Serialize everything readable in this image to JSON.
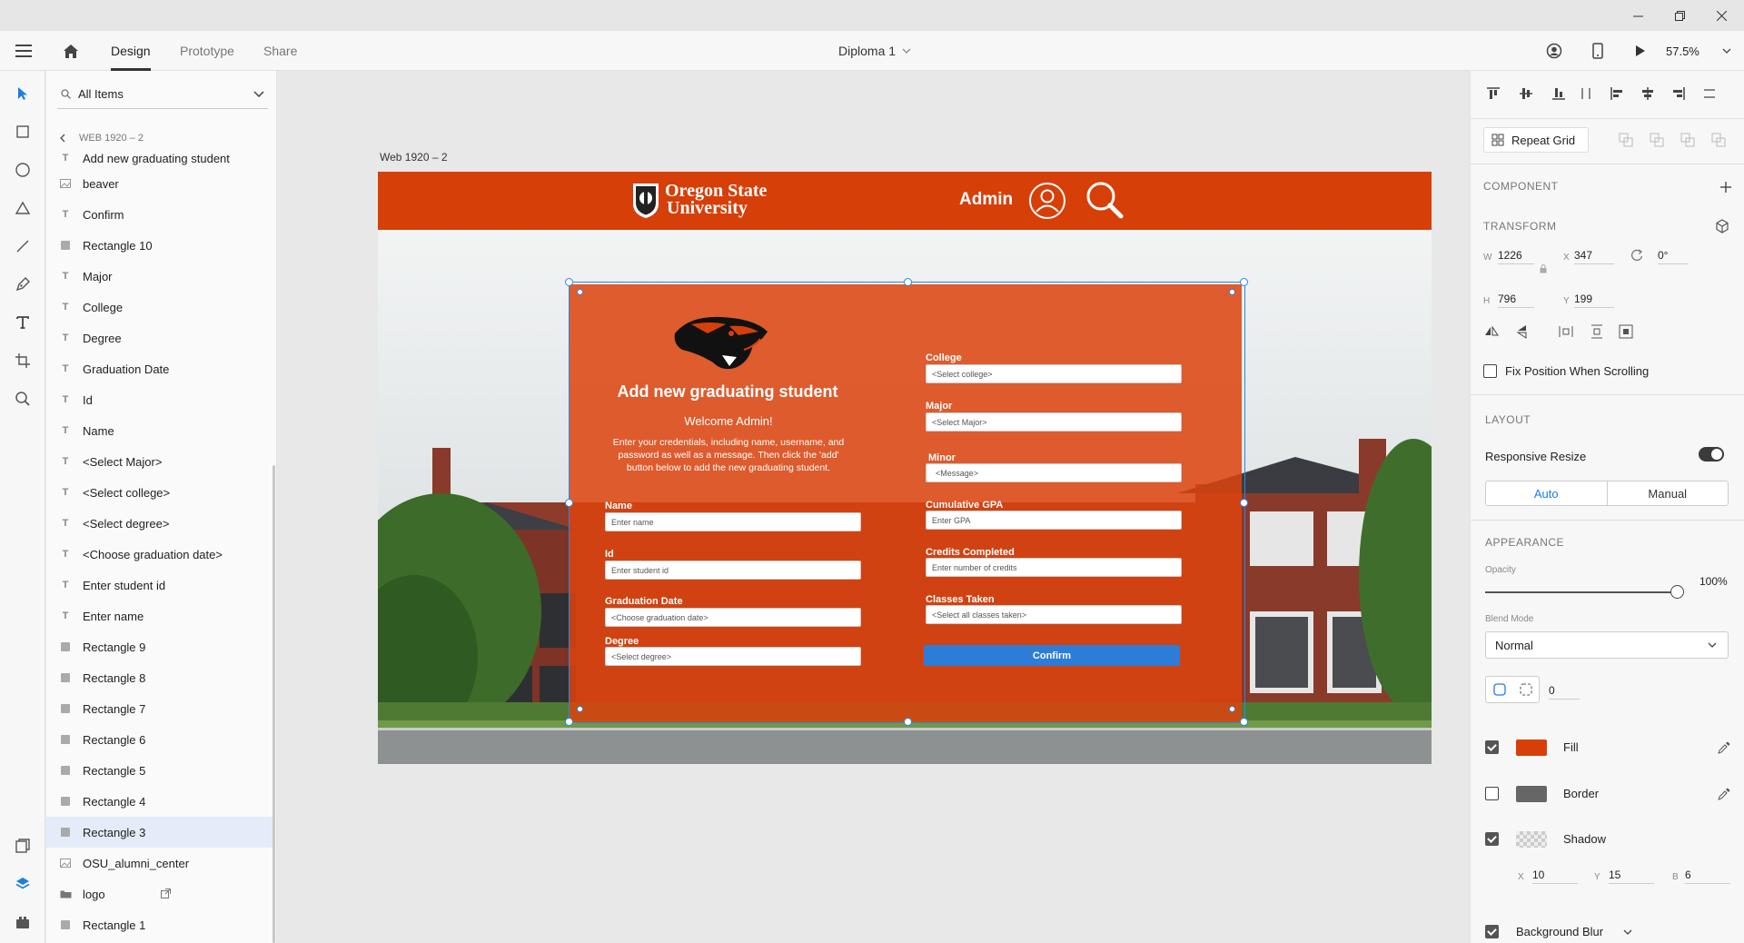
{
  "menubar": {
    "tabs": [
      "Design",
      "Prototype",
      "Share"
    ],
    "active_tab": "Design",
    "document_title": "Diploma 1",
    "zoom": "57.5%"
  },
  "layers": {
    "filter": "All Items",
    "breadcrumb": "WEB 1920 – 2",
    "items": [
      {
        "label": "Add new graduating student",
        "kind": "text"
      },
      {
        "label": "beaver",
        "kind": "image"
      },
      {
        "label": "Confirm",
        "kind": "text"
      },
      {
        "label": "Rectangle 10",
        "kind": "rect"
      },
      {
        "label": "Major",
        "kind": "text"
      },
      {
        "label": "College",
        "kind": "text"
      },
      {
        "label": "Degree",
        "kind": "text"
      },
      {
        "label": "Graduation Date",
        "kind": "text"
      },
      {
        "label": "Id",
        "kind": "text"
      },
      {
        "label": "Name",
        "kind": "text"
      },
      {
        "label": "<Select Major>",
        "kind": "text"
      },
      {
        "label": "<Select college>",
        "kind": "text"
      },
      {
        "label": "<Select degree>",
        "kind": "text"
      },
      {
        "label": "<Choose graduation date>",
        "kind": "text"
      },
      {
        "label": "Enter student id",
        "kind": "text"
      },
      {
        "label": "Enter name",
        "kind": "text"
      },
      {
        "label": "Rectangle 9",
        "kind": "rect"
      },
      {
        "label": "Rectangle 8",
        "kind": "rect"
      },
      {
        "label": "Rectangle 7",
        "kind": "rect"
      },
      {
        "label": "Rectangle 6",
        "kind": "rect"
      },
      {
        "label": "Rectangle 5",
        "kind": "rect"
      },
      {
        "label": "Rectangle 4",
        "kind": "rect"
      },
      {
        "label": "Rectangle 3",
        "kind": "rect",
        "selected": true
      },
      {
        "label": "OSU_alumni_center",
        "kind": "image"
      },
      {
        "label": "logo",
        "kind": "group"
      },
      {
        "label": "Rectangle 1",
        "kind": "rect"
      }
    ]
  },
  "canvas": {
    "artboard_label": "Web 1920 – 2",
    "header": {
      "logo_line1": "Oregon State",
      "logo_line2": "University",
      "admin_label": "Admin"
    },
    "form": {
      "title": "Add new graduating student",
      "welcome": "Welcome Admin!",
      "instructions": "Enter your credentials, including name, username, and password as well as a message. Then click the 'add' button below to add the new graduating student.",
      "left_fields": [
        {
          "label": "Name",
          "placeholder": "Enter name"
        },
        {
          "label": "Id",
          "placeholder": "Enter student id"
        },
        {
          "label": "Graduation Date",
          "placeholder": "<Choose graduation date>"
        },
        {
          "label": "Degree",
          "placeholder": "<Select degree>"
        }
      ],
      "right_fields": [
        {
          "label": "College",
          "placeholder": "<Select college>"
        },
        {
          "label": "Major",
          "placeholder": "<Select Major>"
        },
        {
          "label": "Minor",
          "placeholder": "<Message>"
        },
        {
          "label": "Cumulative GPA",
          "placeholder": "Enter GPA"
        },
        {
          "label": "Credits Completed",
          "placeholder": "Enter number of credits"
        },
        {
          "label": "Classes Taken",
          "placeholder": "<Select all classes taken>"
        }
      ],
      "confirm_label": "Confirm"
    }
  },
  "properties": {
    "repeat_grid": "Repeat Grid",
    "component_heading": "COMPONENT",
    "transform_heading": "TRANSFORM",
    "w": "1226",
    "x": "347",
    "rotation": "0°",
    "h": "796",
    "y": "199",
    "fix_position": "Fix Position When Scrolling",
    "layout_heading": "LAYOUT",
    "responsive_resize": "Responsive Resize",
    "auto": "Auto",
    "manual": "Manual",
    "appearance_heading": "APPEARANCE",
    "opacity_label": "Opacity",
    "opacity_value": "100%",
    "blend_label": "Blend Mode",
    "blend_value": "Normal",
    "corner_radius": "0",
    "fill_label": "Fill",
    "fill_color": "#d73f09",
    "border_label": "Border",
    "border_color": "#666666",
    "shadow_label": "Shadow",
    "shadow_x": "10",
    "shadow_y": "15",
    "shadow_b": "6",
    "background_blur": "Background Blur"
  }
}
